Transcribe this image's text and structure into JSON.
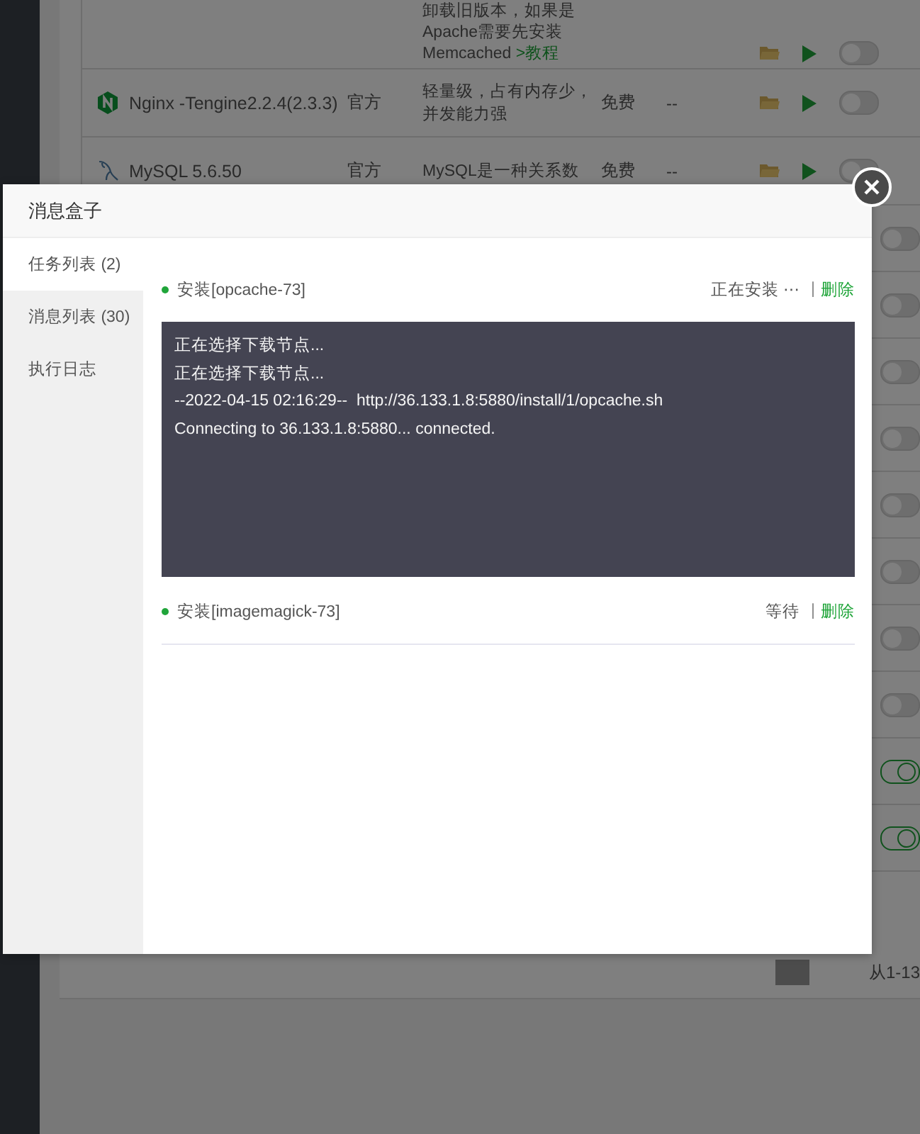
{
  "plugin_table": {
    "rows": [
      {
        "kind": "plugin",
        "description": [
          "卸载旧版本，如果是",
          "Apache需要先安装",
          "Memcached "
        ],
        "link": ">教程",
        "toggle_on": false
      },
      {
        "kind": "nginx",
        "name": "Nginx -Tengine2.2.4(2.3.3)",
        "source": "官方",
        "description": [
          "轻量级，占有内存少，",
          "并发能力强"
        ],
        "price": "免费",
        "expiry": "--",
        "toggle_on": false
      },
      {
        "kind": "mysql",
        "name": "MySQL 5.6.50",
        "source": "官方",
        "description": [
          "MySQL是一种关系数"
        ],
        "price": "免费",
        "expiry": "--",
        "toggle_on": false
      },
      {
        "kind": "hidden",
        "toggle_on": false
      },
      {
        "kind": "hidden",
        "toggle_on": false
      },
      {
        "kind": "hidden",
        "toggle_on": false
      },
      {
        "kind": "hidden",
        "toggle_on": false
      },
      {
        "kind": "hidden",
        "toggle_on": false
      },
      {
        "kind": "hidden",
        "toggle_on": false
      },
      {
        "kind": "hidden",
        "toggle_on": false
      },
      {
        "kind": "hidden",
        "toggle_on": false
      },
      {
        "kind": "hidden",
        "toggle_on": true
      },
      {
        "kind": "hidden",
        "toggle_on": true
      }
    ],
    "pagination_text": "从1-13"
  },
  "dialog": {
    "title": "消息盒子",
    "nav": [
      {
        "label": "任务列表 (2)",
        "selected": true
      },
      {
        "label": "消息列表 (30)",
        "selected": false
      },
      {
        "label": "执行日志",
        "selected": false
      }
    ],
    "tasks": [
      {
        "title": "安装[opcache-73]",
        "status": "正在安装 ⋯",
        "separator": "|",
        "delete": "删除",
        "log": [
          "正在选择下载节点...",
          "正在选择下载节点...",
          "--2022-04-15 02:16:29--  http://36.133.1.8:5880/install/1/opcache.sh",
          "Connecting to 36.133.1.8:5880... connected."
        ]
      },
      {
        "title": "安装[imagemagick-73]",
        "status": "等待",
        "separator": "|",
        "delete": "删除"
      }
    ]
  }
}
